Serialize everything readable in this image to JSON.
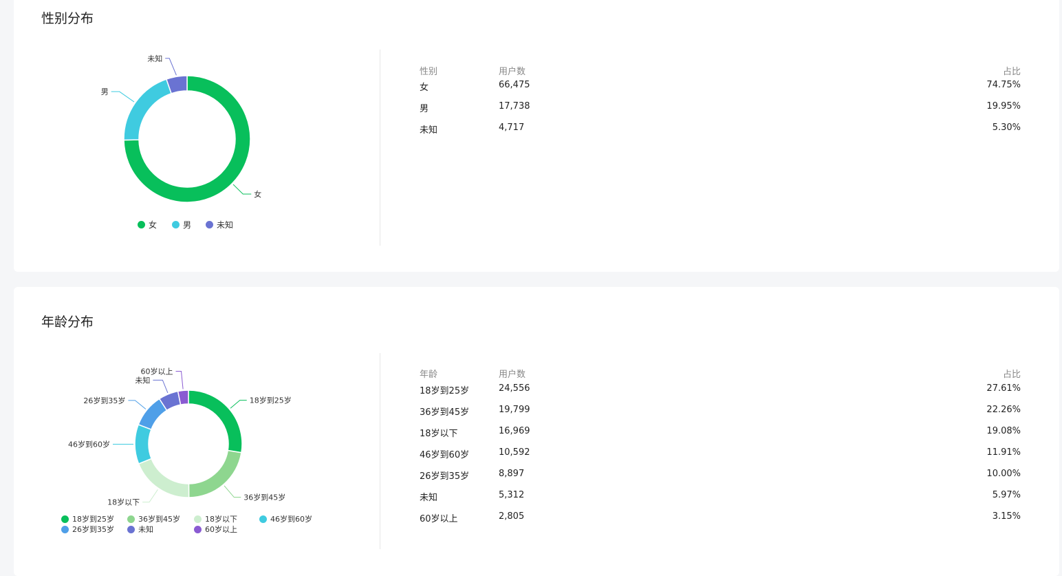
{
  "colors": {
    "green": "#08bf5b",
    "light_green": "#8ed68f",
    "pale_green": "#cdeecf",
    "cyan": "#3fcbe0",
    "blue": "#4f9fe8",
    "indigo": "#6a73d2",
    "purple": "#8a5bd2"
  },
  "gender": {
    "title": "性别分布",
    "table_headers": {
      "name": "性别",
      "users": "用户数",
      "ratio": "占比"
    },
    "rows": [
      {
        "name": "女",
        "users": "66,475",
        "ratio": "74.75%"
      },
      {
        "name": "男",
        "users": "17,738",
        "ratio": "19.95%"
      },
      {
        "name": "未知",
        "users": "4,717",
        "ratio": "5.30%"
      }
    ],
    "chart_data": {
      "type": "pie",
      "donut": true,
      "categories": [
        "女",
        "男",
        "未知"
      ],
      "values": [
        66475,
        17738,
        4717
      ],
      "percentages": [
        74.75,
        19.95,
        5.3
      ],
      "colors": [
        "#08bf5b",
        "#3fcbe0",
        "#6a73d2"
      ],
      "legend": {
        "position": "bottom",
        "labels": [
          "女",
          "男",
          "未知"
        ]
      }
    }
  },
  "age": {
    "title": "年龄分布",
    "table_headers": {
      "name": "年龄",
      "users": "用户数",
      "ratio": "占比"
    },
    "rows": [
      {
        "name": "18岁到25岁",
        "users": "24,556",
        "ratio": "27.61%"
      },
      {
        "name": "36岁到45岁",
        "users": "19,799",
        "ratio": "22.26%"
      },
      {
        "name": "18岁以下",
        "users": "16,969",
        "ratio": "19.08%"
      },
      {
        "name": "46岁到60岁",
        "users": "10,592",
        "ratio": "11.91%"
      },
      {
        "name": "26岁到35岁",
        "users": "8,897",
        "ratio": "10.00%"
      },
      {
        "name": "未知",
        "users": "5,312",
        "ratio": "5.97%"
      },
      {
        "name": "60岁以上",
        "users": "2,805",
        "ratio": "3.15%"
      }
    ],
    "chart_data": {
      "type": "pie",
      "donut": true,
      "categories": [
        "18岁到25岁",
        "36岁到45岁",
        "18岁以下",
        "46岁到60岁",
        "26岁到35岁",
        "未知",
        "60岁以上"
      ],
      "values": [
        24556,
        19799,
        16969,
        10592,
        8897,
        5312,
        2805
      ],
      "percentages": [
        27.61,
        22.26,
        19.08,
        11.91,
        10.0,
        5.97,
        3.15
      ],
      "colors": [
        "#08bf5b",
        "#8ed68f",
        "#cdeecf",
        "#3fcbe0",
        "#4f9fe8",
        "#6a73d2",
        "#8a5bd2"
      ],
      "legend": {
        "position": "bottom",
        "labels": [
          "18岁到25岁",
          "36岁到45岁",
          "18岁以下",
          "46岁到60岁",
          "26岁到35岁",
          "未知",
          "60岁以上"
        ]
      }
    }
  }
}
